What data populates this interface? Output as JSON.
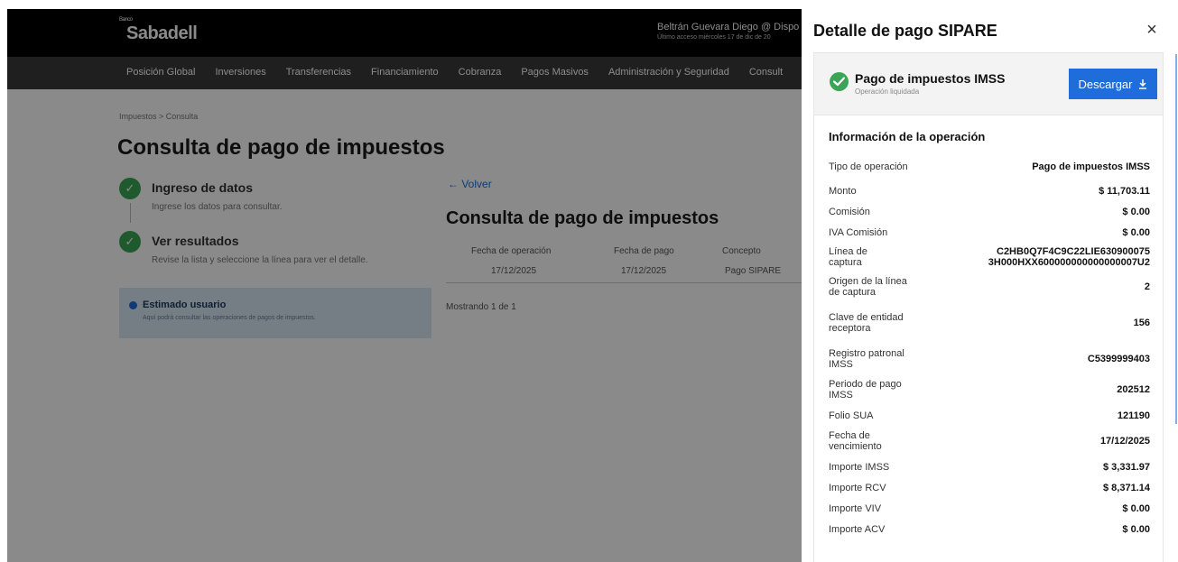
{
  "background": {
    "brand": {
      "sup": "Banco",
      "name": "Sabadell"
    },
    "user": {
      "name": "Beltrán Guevara Diego @ Dispo",
      "last_access": "Último acceso miércoles 17 de dic de 20"
    },
    "nav": [
      "Posición Global",
      "Inversiones",
      "Transferencias",
      "Financiamiento",
      "Cobranza",
      "Pagos Masivos",
      "Administración y Seguridad",
      "Consult"
    ],
    "breadcrumb": "Impuestos  >  Consulta",
    "page_title": "Consulta de pago de impuestos",
    "steps": [
      {
        "title": "Ingreso de datos",
        "desc": "Ingrese los datos para consultar."
      },
      {
        "title": "Ver resultados",
        "desc": "Revise la lista y seleccione la línea para ver el detalle."
      }
    ],
    "info_box": {
      "title": "Estimado usuario",
      "desc": "Aquí podrá consultar las operaciones de pagos de impuestos."
    },
    "back_link": "← Volver",
    "results_title": "Consulta de pago de impuestos",
    "table": {
      "headers": [
        "Fecha de operación",
        "Fecha de pago",
        "Concepto"
      ],
      "row": [
        "17/12/2025",
        "17/12/2025",
        "Pago SIPARE"
      ]
    },
    "showing": "Mostrando 1 de 1"
  },
  "panel": {
    "title": "Detalle de pago SIPARE",
    "close_icon": "close-icon",
    "operation": {
      "name": "Pago de impuestos IMSS",
      "status": "Operación liquidada"
    },
    "download_label": "Descargar",
    "section_title": "Información de la operación",
    "rows": [
      {
        "label": "Tipo de operación",
        "value": "Pago de impuestos IMSS",
        "h": 30
      },
      {
        "label": "Monto",
        "value": "$ 11,703.11",
        "h": 23
      },
      {
        "label": "Comisión",
        "value": "$ 0.00",
        "h": 23
      },
      {
        "label": "IVA Comisión",
        "value": "$ 0.00",
        "h": 23
      },
      {
        "label": "Línea de captura",
        "value": "C2HB0Q7F4C9C22LIE630900075 3H000HXX600000000000000007U2",
        "h": 32
      },
      {
        "label": "Origen de la línea de captura",
        "value": "2",
        "h": 34
      },
      {
        "label": "Clave de entidad receptora",
        "value": "156",
        "h": 46
      },
      {
        "label": "Registro patronal IMSS",
        "value": "C5399999403",
        "h": 34
      },
      {
        "label": "Periodo de pago IMSS",
        "value": "202512",
        "h": 34
      },
      {
        "label": "Folio SUA",
        "value": "121190",
        "h": 23
      },
      {
        "label": "Fecha de vencimiento",
        "value": "17/12/2025",
        "h": 34
      },
      {
        "label": "Importe IMSS",
        "value": "$ 3,331.97",
        "h": 23
      },
      {
        "label": "Importe RCV",
        "value": "$ 8,371.14",
        "h": 23
      },
      {
        "label": "Importe VIV",
        "value": "$ 0.00",
        "h": 23
      },
      {
        "label": "Importe ACV",
        "value": "$ 0.00",
        "h": 23
      }
    ]
  },
  "colors": {
    "accent": "#1f6cdb",
    "success": "#3aa556",
    "overlay": "rgba(0,0,0,0.46)"
  }
}
